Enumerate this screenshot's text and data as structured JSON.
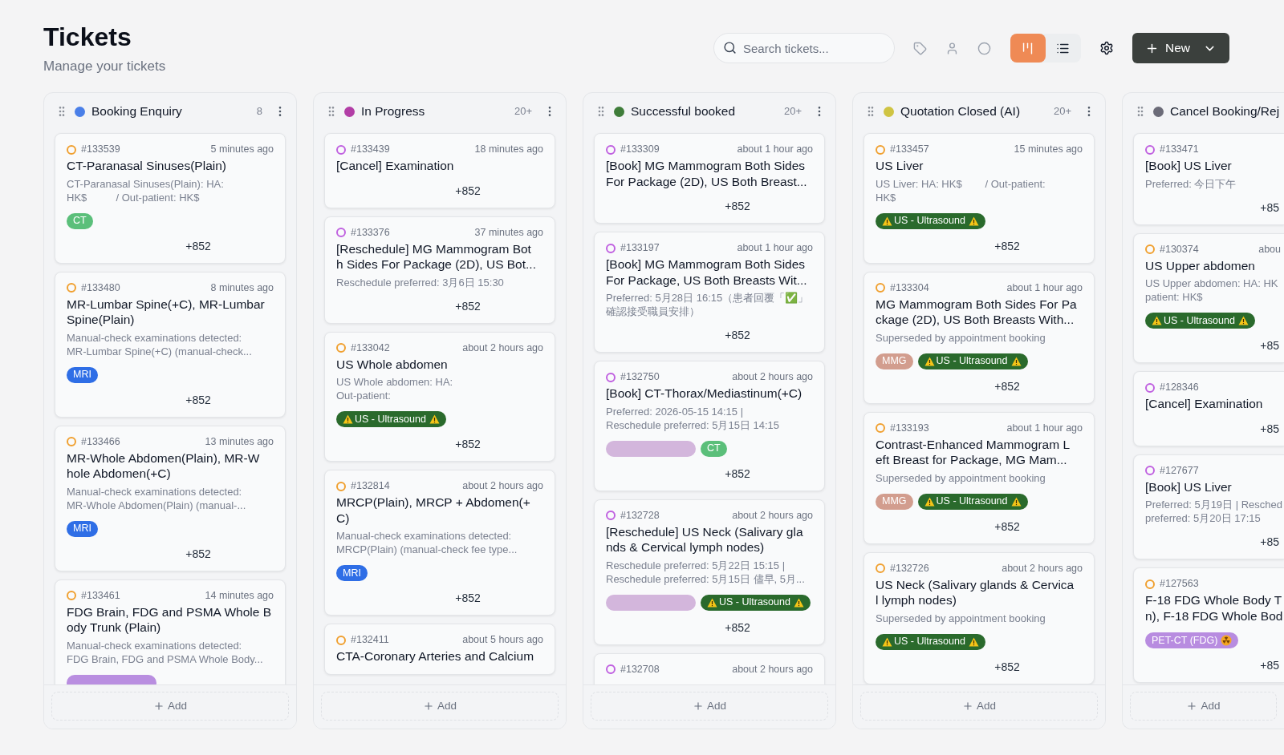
{
  "header": {
    "title": "Tickets",
    "subtitle": "Manage your tickets"
  },
  "toolbar": {
    "search": {
      "placeholder": "Search tickets..."
    },
    "views": [
      {
        "kind": "board",
        "selected": true
      },
      {
        "kind": "list",
        "selected": false
      }
    ],
    "new_button": "New"
  },
  "columns": [
    {
      "name": "Booking Enquiry",
      "color": "#4a7fe8",
      "count": "8",
      "add_label": "Add",
      "cards": [
        {
          "id": "#133539",
          "time": "5 minutes ago",
          "color": "#f0a030",
          "title": [
            "CT-Paranasal Sinuses(Plain)"
          ],
          "desc": [
            "CT-Paranasal Sinuses(Plain): HA:",
            "HK$          / Out-patient: HK$"
          ],
          "tags": [
            {
              "kind": "plain",
              "text": "CT",
              "color": "#5bbf7a"
            }
          ],
          "phone": "+852"
        },
        {
          "id": "#133480",
          "time": "8 minutes ago",
          "color": "#f0a030",
          "title": [
            "MR-Lumbar Spine(+C), MR-Lumbar",
            "Spine(Plain)"
          ],
          "desc": [
            "Manual-check examinations detected:",
            "MR-Lumbar Spine(+C) (manual-check..."
          ],
          "tags": [
            {
              "kind": "plain",
              "text": "MRI",
              "color": "#2f6ee6"
            }
          ],
          "phone": "+852"
        },
        {
          "id": "#133466",
          "time": "13 minutes ago",
          "color": "#f0a030",
          "title": [
            "MR-Whole Abdomen(Plain), MR-W",
            "hole Abdomen(+C)"
          ],
          "desc": [
            "Manual-check examinations detected:",
            "MR-Whole Abdomen(Plain) (manual-..."
          ],
          "tags": [
            {
              "kind": "plain",
              "text": "MRI",
              "color": "#2f6ee6"
            }
          ],
          "phone": "+852"
        },
        {
          "id": "#133461",
          "time": "14 minutes ago",
          "color": "#f0a030",
          "title": [
            "FDG Brain, FDG and PSMA Whole B",
            "ody Trunk (Plain)"
          ],
          "desc": [
            "Manual-check examinations detected:",
            "FDG Brain, FDG and PSMA Whole Body..."
          ],
          "tags": [
            {
              "kind": "blank",
              "color": "#b98ee0"
            }
          ]
        }
      ]
    },
    {
      "name": "In Progress",
      "color": "#b23ea6",
      "count": "20+",
      "add_label": "Add",
      "cards": [
        {
          "id": "#133439",
          "time": "18 minutes ago",
          "color": "#c061e0",
          "title": [
            "[Cancel] Examination"
          ],
          "phone": "+852"
        },
        {
          "id": "#133376",
          "time": "37 minutes ago",
          "color": "#c061e0",
          "title": [
            "[Reschedule] MG Mammogram Bot",
            "h Sides For Package (2D), US Bot..."
          ],
          "desc": [
            "Reschedule preferred: 3月6日 15:30"
          ],
          "phone": "+852"
        },
        {
          "id": "#133042",
          "time": "about 2 hours ago",
          "color": "#f0a030",
          "title": [
            "US Whole abdomen"
          ],
          "desc": [
            "US Whole abdomen: HA:",
            "Out-patient:"
          ],
          "tags": [
            {
              "kind": "warning",
              "text": "US - Ultrasound",
              "color": "#2a6a2c"
            }
          ],
          "phone": "+852"
        },
        {
          "id": "#132814",
          "time": "about 2 hours ago",
          "color": "#f0a030",
          "title": [
            "MRCP(Plain), MRCP + Abdomen(+",
            "C)"
          ],
          "desc": [
            "Manual-check examinations detected:",
            "MRCP(Plain) (manual-check fee type..."
          ],
          "tags": [
            {
              "kind": "plain",
              "text": "MRI",
              "color": "#2f6ee6"
            }
          ],
          "phone": "+852"
        },
        {
          "id": "#132411",
          "time": "about 5 hours ago",
          "color": "#f0a030",
          "title": [
            "CTA-Coronary Arteries and Calcium"
          ]
        }
      ]
    },
    {
      "name": "Successful booked",
      "color": "#3f7d3a",
      "count": "20+",
      "add_label": "Add",
      "cards": [
        {
          "id": "#133309",
          "time": "about 1 hour ago",
          "color": "#c061e0",
          "title": [
            "[Book] MG Mammogram Both Sides",
            "For Package (2D), US Both Breast..."
          ],
          "phone": "+852"
        },
        {
          "id": "#133197",
          "time": "about 1 hour ago",
          "color": "#c061e0",
          "title": [
            "[Book] MG Mammogram Both Sides",
            "For Package, US Both Breasts Wit..."
          ],
          "desc": [
            "Preferred: 5月28日 16:15（患者回覆「✅」",
            "確認接受職員安排）"
          ],
          "phone": "+852"
        },
        {
          "id": "#132750",
          "time": "about 2 hours ago",
          "color": "#c061e0",
          "title": [
            "[Book] CT-Thorax/Mediastinum(+C)"
          ],
          "desc": [
            "Preferred: 2026-05-15 14:15 |",
            "Reschedule preferred: 5月15日 14:15"
          ],
          "tags": [
            {
              "kind": "blank",
              "color": "#d3b6dc"
            },
            {
              "kind": "plain",
              "text": "CT",
              "color": "#5bbf7a"
            }
          ],
          "phone": "+852"
        },
        {
          "id": "#132728",
          "time": "about 2 hours ago",
          "color": "#c061e0",
          "title": [
            "[Reschedule] US Neck (Salivary gla",
            "nds & Cervical lymph nodes)"
          ],
          "desc": [
            "Reschedule preferred: 5月22日 15:15 |",
            "Reschedule preferred: 5月15日 儘早, 5月..."
          ],
          "tags": [
            {
              "kind": "blank",
              "color": "#d3b6dc"
            },
            {
              "kind": "warning",
              "text": "US - Ultrasound",
              "color": "#2a6a2c"
            }
          ],
          "phone": "+852"
        },
        {
          "id": "#132708",
          "time": "about 2 hours ago",
          "color": "#c061e0"
        }
      ]
    },
    {
      "name": "Quotation Closed (AI)",
      "color": "#cfc443",
      "count": "20+",
      "add_label": "Add",
      "cards": [
        {
          "id": "#133457",
          "time": "15 minutes ago",
          "color": "#f0a030",
          "title": [
            "US Liver"
          ],
          "desc": [
            "US Liver: HA: HK$        / Out-patient:",
            "HK$"
          ],
          "tags": [
            {
              "kind": "warning",
              "text": "US - Ultrasound",
              "color": "#2a6a2c"
            }
          ],
          "phone": "+852"
        },
        {
          "id": "#133304",
          "time": "about 1 hour ago",
          "color": "#f0a030",
          "title": [
            "MG Mammogram Both Sides For Pa",
            "ckage (2D), US Both Breasts With..."
          ],
          "desc": [
            "Superseded by appointment booking"
          ],
          "tags": [
            {
              "kind": "plain",
              "text": "MMG",
              "color": "#d29d8e"
            },
            {
              "kind": "warning",
              "text": "US - Ultrasound",
              "color": "#2a6a2c"
            }
          ],
          "phone": "+852"
        },
        {
          "id": "#133193",
          "time": "about 1 hour ago",
          "color": "#f0a030",
          "title": [
            "Contrast-Enhanced Mammogram L",
            "eft Breast for Package, MG Mam..."
          ],
          "desc": [
            "Superseded by appointment booking"
          ],
          "tags": [
            {
              "kind": "plain",
              "text": "MMG",
              "color": "#d29d8e"
            },
            {
              "kind": "warning",
              "text": "US - Ultrasound",
              "color": "#2a6a2c"
            }
          ],
          "phone": "+852"
        },
        {
          "id": "#132726",
          "time": "about 2 hours ago",
          "color": "#f0a030",
          "title": [
            "US Neck (Salivary glands & Cervica",
            "l lymph nodes)"
          ],
          "desc": [
            "Superseded by appointment booking"
          ],
          "tags": [
            {
              "kind": "warning",
              "text": "US - Ultrasound",
              "color": "#2a6a2c"
            }
          ],
          "phone": "+852"
        }
      ]
    },
    {
      "name": "Cancel Booking/Rej",
      "color": "#6b6b78",
      "add_label": "Add",
      "cards": [
        {
          "id": "#133471",
          "color": "#c061e0",
          "title": [
            "[Book] US Liver"
          ],
          "desc": [
            "Preferred: 今日下午"
          ],
          "phone": "+85"
        },
        {
          "id": "#130374",
          "time": "abou",
          "color": "#f0a030",
          "title": [
            "US Upper abdomen"
          ],
          "desc": [
            "US Upper abdomen: HA: HK",
            "patient: HK$"
          ],
          "tags": [
            {
              "kind": "warning",
              "text": "US - Ultrasound",
              "color": "#2a6a2c"
            }
          ],
          "phone": "+85"
        },
        {
          "id": "#128346",
          "color": "#c061e0",
          "title": [
            "[Cancel] Examination"
          ],
          "phone": "+85"
        },
        {
          "id": "#127677",
          "color": "#c061e0",
          "title": [
            "[Book] US Liver"
          ],
          "desc": [
            "Preferred: 5月19日 | Resched",
            "preferred: 5月20日 17:15"
          ],
          "phone": "+85"
        },
        {
          "id": "#127563",
          "color": "#f0a030",
          "title": [
            "F-18 FDG Whole Body T",
            "n), F-18 FDG Whole Bod"
          ],
          "tags": [
            {
              "kind": "radiation",
              "text": "PET-CT (FDG)",
              "color": "#b88ce0"
            }
          ],
          "phone": "+85"
        }
      ]
    }
  ]
}
